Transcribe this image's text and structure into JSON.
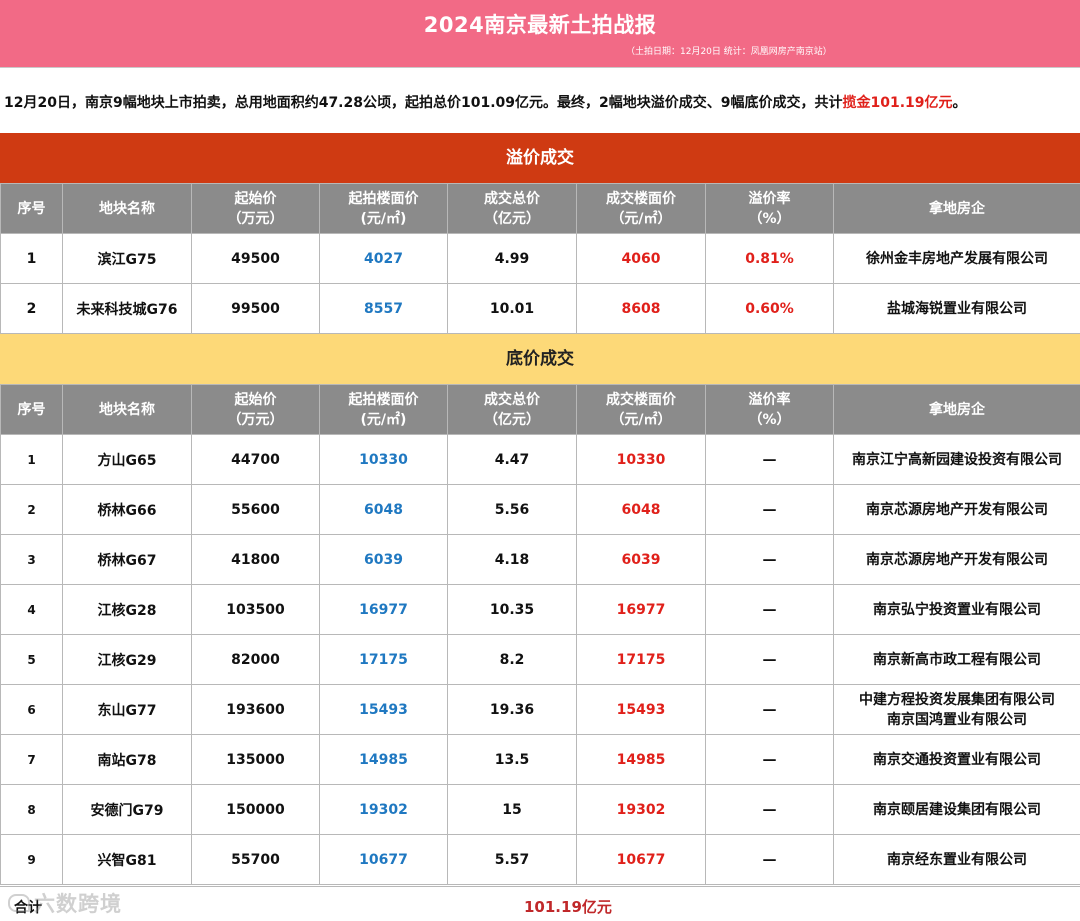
{
  "header": {
    "title": "2024南京最新土拍战报",
    "subtitle": "（土拍日期：12月20日   统计：凤凰网房产南京站）"
  },
  "summary": {
    "text": "12月20日，南京9幅地块上市拍卖，总用地面积约47.28公顷，起拍总价101.09亿元。最终，2幅地块溢价成交、9幅底价成交，共计",
    "highlight": "揽金101.19亿元",
    "end": "。"
  },
  "columns": [
    "序号",
    "地块名称",
    "起始价\n（万元）",
    "起拍楼面价\n(元/㎡)",
    "成交总价\n（亿元）",
    "成交楼面价\n（元/㎡）",
    "溢价率\n（%）",
    "拿地房企"
  ],
  "premium": {
    "title": "溢价成交",
    "rows": [
      {
        "no": "1",
        "name": "滨江G75",
        "start": "49500",
        "start_floor": "4027",
        "total": "4.99",
        "deal_floor": "4060",
        "rate": "0.81%",
        "company": "徐州金丰房地产发展有限公司"
      },
      {
        "no": "2",
        "name": "未来科技城G76",
        "start": "99500",
        "start_floor": "8557",
        "total": "10.01",
        "deal_floor": "8608",
        "rate": "0.60%",
        "company": "盐城海锐置业有限公司"
      }
    ]
  },
  "floor": {
    "title": "底价成交",
    "rows": [
      {
        "no": "1",
        "name": "方山G65",
        "start": "44700",
        "start_floor": "10330",
        "total": "4.47",
        "deal_floor": "10330",
        "rate": "—",
        "company": "南京江宁高新园建设投资有限公司"
      },
      {
        "no": "2",
        "name": "桥林G66",
        "start": "55600",
        "start_floor": "6048",
        "total": "5.56",
        "deal_floor": "6048",
        "rate": "—",
        "company": "南京芯源房地产开发有限公司"
      },
      {
        "no": "3",
        "name": "桥林G67",
        "start": "41800",
        "start_floor": "6039",
        "total": "4.18",
        "deal_floor": "6039",
        "rate": "—",
        "company": "南京芯源房地产开发有限公司"
      },
      {
        "no": "4",
        "name": "江核G28",
        "start": "103500",
        "start_floor": "16977",
        "total": "10.35",
        "deal_floor": "16977",
        "rate": "—",
        "company": "南京弘宁投资置业有限公司"
      },
      {
        "no": "5",
        "name": "江核G29",
        "start": "82000",
        "start_floor": "17175",
        "total": "8.2",
        "deal_floor": "17175",
        "rate": "—",
        "company": "南京新高市政工程有限公司"
      },
      {
        "no": "6",
        "name": "东山G77",
        "start": "193600",
        "start_floor": "15493",
        "total": "19.36",
        "deal_floor": "15493",
        "rate": "—",
        "company": "中建方程投资发展集团有限公司\n南京国鸿置业有限公司"
      },
      {
        "no": "7",
        "name": "南站G78",
        "start": "135000",
        "start_floor": "14985",
        "total": "13.5",
        "deal_floor": "14985",
        "rate": "—",
        "company": "南京交通投资置业有限公司"
      },
      {
        "no": "8",
        "name": "安德门G79",
        "start": "150000",
        "start_floor": "19302",
        "total": "15",
        "deal_floor": "19302",
        "rate": "—",
        "company": "南京颐居建设集团有限公司"
      },
      {
        "no": "9",
        "name": "兴智G81",
        "start": "55700",
        "start_floor": "10677",
        "total": "5.57",
        "deal_floor": "10677",
        "rate": "—",
        "company": "南京经东置业有限公司"
      }
    ]
  },
  "total": {
    "label": "合计",
    "value": "101.19亿元"
  },
  "watermark": "六数跨境"
}
